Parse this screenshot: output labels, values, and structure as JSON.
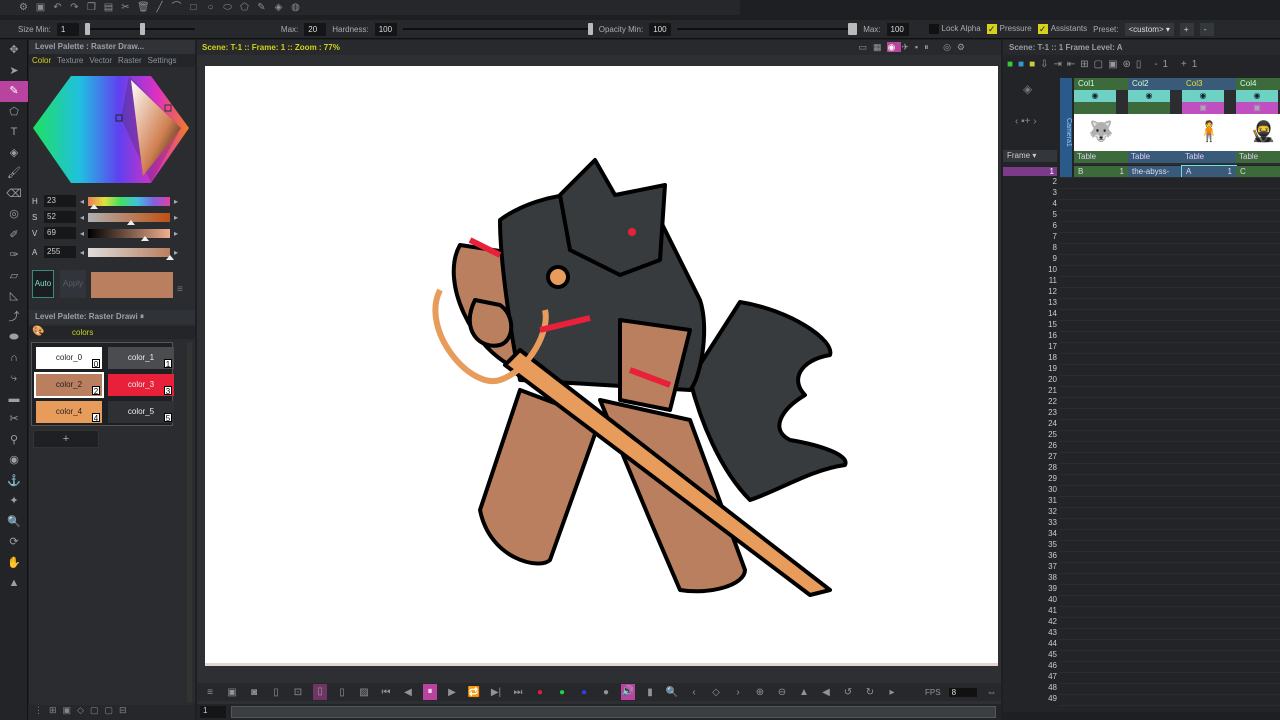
{
  "tool_options": {
    "size_min_label": "Size Min:",
    "size_min": "1",
    "max_label": "Max:",
    "max": "20",
    "hardness_label": "Hardness:",
    "hardness": "100",
    "opacity_min_label": "Opacity Min:",
    "opacity_min": "100",
    "opacity_max_label": "Max:",
    "opacity_max": "100",
    "lock_alpha": "Lock Alpha",
    "pressure": "Pressure",
    "assistants": "Assistants",
    "preset_label": "Preset:",
    "preset": "<custom>",
    "add": "+",
    "remove": "-"
  },
  "style_editor": {
    "title": "Level Palette : Raster Draw...",
    "tabs": [
      "Color",
      "Texture",
      "Vector",
      "Raster",
      "Settings"
    ],
    "h_label": "H",
    "h": "23",
    "s_label": "S",
    "s": "52",
    "v_label": "V",
    "v": "69",
    "a_label": "A",
    "a": "255",
    "auto": "Auto",
    "apply": "Apply",
    "current_color": "#b97f5e"
  },
  "level_palette": {
    "title": "Level Palette: Raster Drawi",
    "page": "colors",
    "add": "+",
    "styles": [
      {
        "name": "color_0",
        "index": "0",
        "color": "#ffffff"
      },
      {
        "name": "color_1",
        "index": "1",
        "color": "#4a4c50"
      },
      {
        "name": "color_2",
        "index": "2",
        "color": "#b97f5e"
      },
      {
        "name": "color_3",
        "index": "3",
        "color": "#e8203a"
      },
      {
        "name": "color_4",
        "index": "4",
        "color": "#e89c5c"
      },
      {
        "name": "color_5",
        "index": "5",
        "color": "#2e3034"
      }
    ]
  },
  "viewer": {
    "status": "Scene: T-1  ::  Frame: 1  ::  Zoom : 77%",
    "fps_label": "FPS",
    "fps": "8",
    "frame_field": "1"
  },
  "xsheet": {
    "status": "Scene: T-1  ::  1 Frame  Level: A",
    "frame_label": "Frame",
    "camera": "Camera1",
    "columns": [
      {
        "name": "Col1",
        "pegbar": "Table",
        "cell": "B",
        "cell_frame": "1"
      },
      {
        "name": "Col2",
        "pegbar": "Table",
        "cell": "the-abyss-",
        "cell_frame": ""
      },
      {
        "name": "Col3",
        "pegbar": "Table",
        "cell": "A",
        "cell_frame": "1"
      },
      {
        "name": "Col4",
        "pegbar": "Table",
        "cell": "C",
        "cell_frame": ""
      }
    ],
    "current_frame": "1"
  }
}
